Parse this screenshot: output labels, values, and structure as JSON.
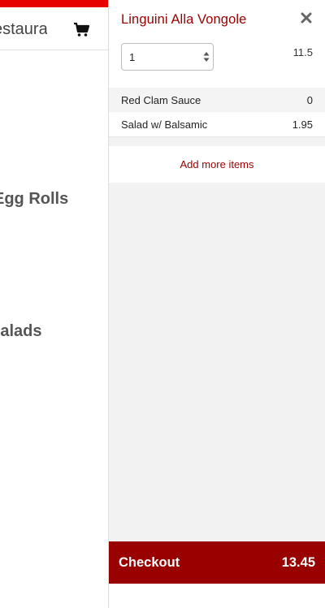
{
  "background": {
    "search_text": "estaurant",
    "sections": [
      "Egg Rolls",
      "Salads"
    ],
    "icons": {
      "cart": "shopping-cart-icon"
    },
    "colors": {
      "top_bar": "#e60000"
    }
  },
  "panel": {
    "item_title": "Linguini Alla Vongole",
    "quantity": "1",
    "item_price": "11.5",
    "options": [
      {
        "name": "Red Clam Sauce",
        "price": "0"
      },
      {
        "name": "Salad w/ Balsamic",
        "price": "1.95"
      }
    ],
    "add_more_label": "Add more items",
    "checkout_label": "Checkout",
    "checkout_total": "13.45",
    "icons": {
      "close": "close-icon",
      "quantity_arrows": "updown-arrows-icon"
    },
    "colors": {
      "accent": "#990000"
    }
  }
}
